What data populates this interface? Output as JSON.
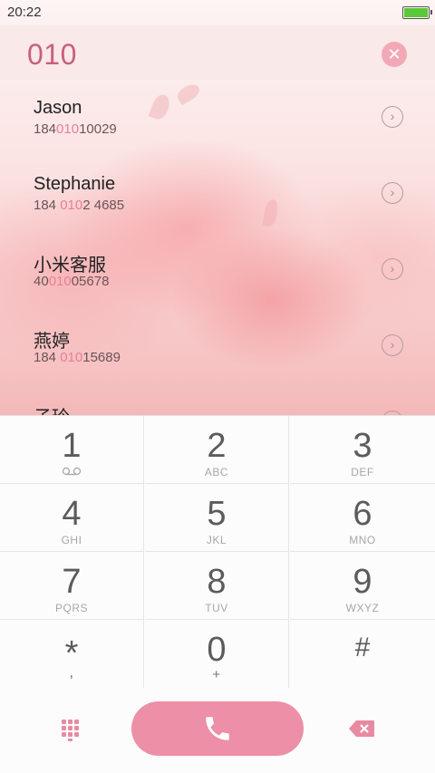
{
  "status_bar": {
    "time": "20:22",
    "battery_level": 1.0
  },
  "search": {
    "query": "010",
    "clear_icon": "close-icon"
  },
  "contacts": [
    {
      "name": "Jason",
      "number_parts": [
        "184",
        "010",
        "10029"
      ]
    },
    {
      "name": "Stephanie",
      "number_parts": [
        "184 ",
        "010",
        "2 4685"
      ]
    },
    {
      "name": "小米客服",
      "number_parts": [
        "40",
        "010",
        "05678"
      ]
    },
    {
      "name": "燕婷",
      "number_parts": [
        "184 ",
        "010",
        "15689"
      ]
    },
    {
      "name": "子玲",
      "number_parts": [
        "",
        "",
        ""
      ]
    }
  ],
  "keypad": [
    {
      "digit": "1",
      "letters": "",
      "sub_icon": "voicemail-icon"
    },
    {
      "digit": "2",
      "letters": "ABC"
    },
    {
      "digit": "3",
      "letters": "DEF"
    },
    {
      "digit": "4",
      "letters": "GHI"
    },
    {
      "digit": "5",
      "letters": "JKL"
    },
    {
      "digit": "6",
      "letters": "MNO"
    },
    {
      "digit": "7",
      "letters": "PQRS"
    },
    {
      "digit": "8",
      "letters": "TUV"
    },
    {
      "digit": "9",
      "letters": "WXYZ"
    },
    {
      "digit": "*",
      "letters": ","
    },
    {
      "digit": "0",
      "letters": "+"
    },
    {
      "digit": "#",
      "letters": ""
    }
  ],
  "bottom_bar": {
    "left_icon": "dialpad-icon",
    "call_icon": "phone-icon",
    "right_icon": "backspace-icon"
  },
  "colors": {
    "accent": "#ec8fa7",
    "highlight": "#e97f98",
    "query": "#c7607a"
  }
}
